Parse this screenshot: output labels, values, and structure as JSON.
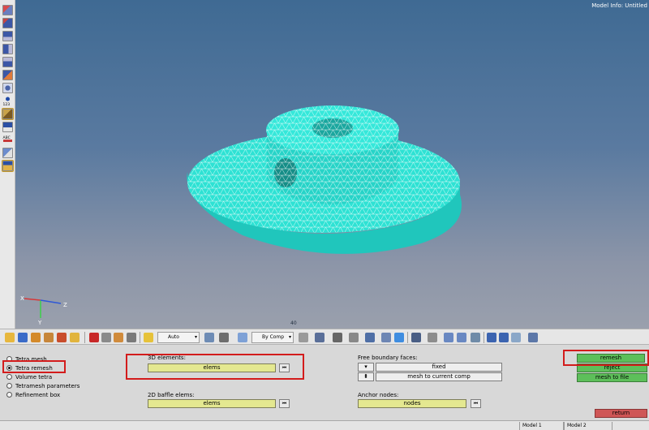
{
  "viewport": {
    "model_info": "Model Info: Untitled",
    "scale_label": "40",
    "triad": {
      "x": "X",
      "y": "Y",
      "z": "Z"
    }
  },
  "left_toolbar": {
    "icons": [
      "view-top-icon",
      "view-iso-icon",
      "view-front-icon",
      "view-side-icon",
      "view-bottom-icon",
      "view-back-icon",
      "cylinder-icon",
      "magnet-icon",
      "info-123-icon",
      "ruler-icon",
      "mesh-abc-icon",
      "label-abc-icon",
      "component-icon",
      "book-icon"
    ]
  },
  "toolbar": {
    "auto_dropdown": "Auto",
    "by_comp_dropdown": "By Comp"
  },
  "panel": {
    "radios": [
      {
        "label": "Tetra mesh",
        "selected": false
      },
      {
        "label": "Tetra remesh",
        "selected": true
      },
      {
        "label": "Volume tetra",
        "selected": false
      },
      {
        "label": "Tetramesh parameters",
        "selected": false
      },
      {
        "label": "Refinement box",
        "selected": false
      }
    ],
    "elements_3d": {
      "label": "3D elements:",
      "selector": "elems"
    },
    "baffle_2d": {
      "label": "2D baffle elems:",
      "selector": "elems"
    },
    "free_boundary": {
      "label": "Free boundary faces:",
      "option1": "fixed",
      "option2": "mesh to current comp"
    },
    "anchor_nodes": {
      "label": "Anchor nodes:",
      "selector": "nodes"
    },
    "actions": {
      "remesh": "remesh",
      "reject": "reject",
      "mesh_to_file": "mesh to file",
      "return": "return"
    }
  },
  "status_bar": {
    "tabs": [
      "Model 1",
      "Model 2"
    ]
  },
  "colors": {
    "mesh": "#2ee2d4",
    "viewport_top": "#3f6a93",
    "selector_yellow": "#e4e890",
    "green": "#5dbf5a",
    "red": "#cf5656",
    "annotation": "#d31c1c"
  }
}
